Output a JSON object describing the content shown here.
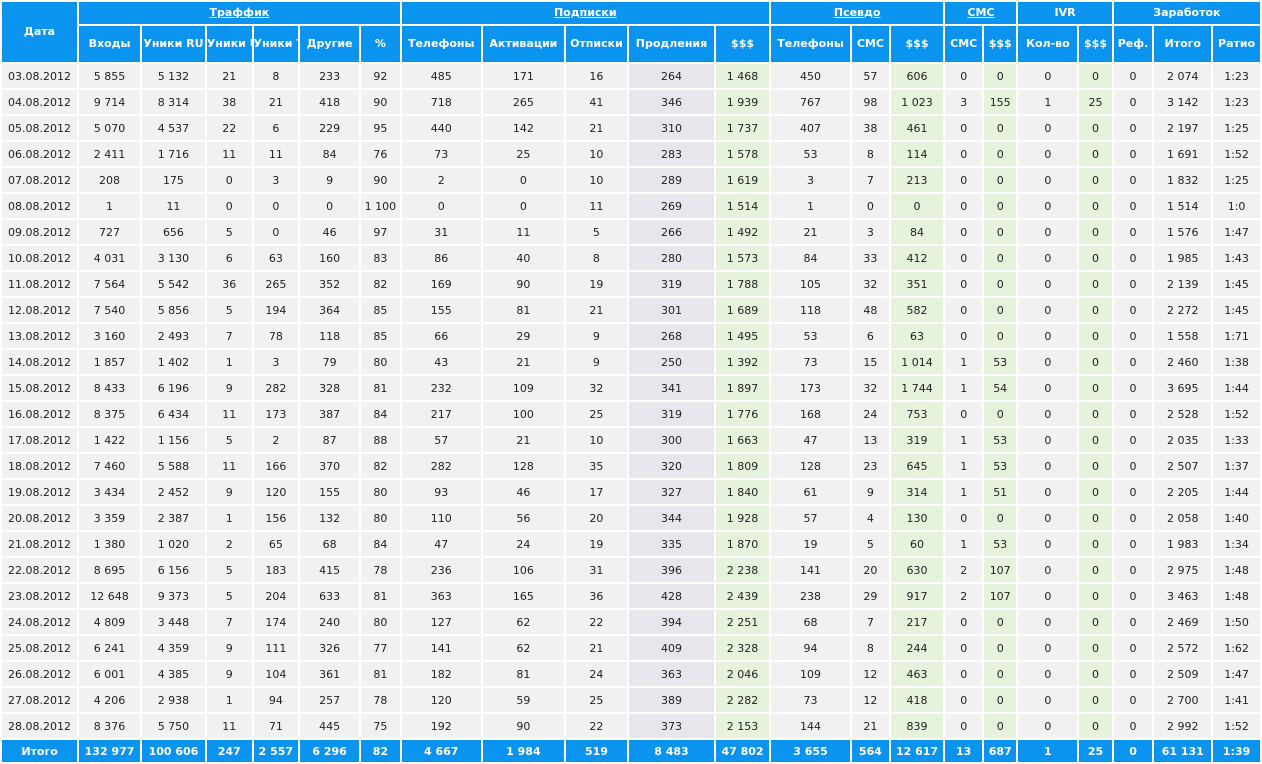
{
  "table": {
    "groups": [
      {
        "label": "Дата",
        "span": 1,
        "link": false,
        "key": "date"
      },
      {
        "label": "Траффик",
        "span": 6,
        "link": true,
        "key": "traffic"
      },
      {
        "label": "Подписки",
        "span": 5,
        "link": true,
        "key": "subscriptions"
      },
      {
        "label": "Псевдо",
        "span": 3,
        "link": true,
        "key": "pseudo"
      },
      {
        "label": "СМС",
        "span": 2,
        "link": true,
        "key": "sms"
      },
      {
        "label": "IVR",
        "span": 2,
        "link": false,
        "key": "ivr"
      },
      {
        "label": "Заработок",
        "span": 3,
        "link": false,
        "key": "earnings"
      }
    ],
    "columns": [
      {
        "label": "Входы",
        "kind": "plain"
      },
      {
        "label": "Уники RU",
        "kind": "plain"
      },
      {
        "label": "Уники UA",
        "kind": "plain"
      },
      {
        "label": "Уники ТБ",
        "kind": "plain"
      },
      {
        "label": "Другие",
        "kind": "plain"
      },
      {
        "label": "%",
        "kind": "plain"
      },
      {
        "label": "Телефоны",
        "kind": "link"
      },
      {
        "label": "Активации",
        "kind": "link"
      },
      {
        "label": "Отписки",
        "kind": "link"
      },
      {
        "label": "Продления",
        "kind": "prod"
      },
      {
        "label": "$$$",
        "kind": "money"
      },
      {
        "label": "Телефоны",
        "kind": "link"
      },
      {
        "label": "СМС",
        "kind": "link"
      },
      {
        "label": "$$$",
        "kind": "money"
      },
      {
        "label": "СМС",
        "kind": "link"
      },
      {
        "label": "$$$",
        "kind": "money"
      },
      {
        "label": "Кол-во",
        "kind": "link"
      },
      {
        "label": "$$$",
        "kind": "money"
      },
      {
        "label": "Реф.",
        "kind": "plain"
      },
      {
        "label": "Итого",
        "kind": "plain"
      },
      {
        "label": "Ратио",
        "kind": "plain"
      }
    ],
    "rows": [
      [
        "03.08.2012",
        "5 855",
        "5 132",
        "21",
        "8",
        "233",
        "92",
        "485",
        "171",
        "16",
        "264",
        "1 468",
        "450",
        "57",
        "606",
        "0",
        "0",
        "0",
        "0",
        "0",
        "2 074",
        "1:23"
      ],
      [
        "04.08.2012",
        "9 714",
        "8 314",
        "38",
        "21",
        "418",
        "90",
        "718",
        "265",
        "41",
        "346",
        "1 939",
        "767",
        "98",
        "1 023",
        "3",
        "155",
        "1",
        "25",
        "0",
        "3 142",
        "1:23"
      ],
      [
        "05.08.2012",
        "5 070",
        "4 537",
        "22",
        "6",
        "229",
        "95",
        "440",
        "142",
        "21",
        "310",
        "1 737",
        "407",
        "38",
        "461",
        "0",
        "0",
        "0",
        "0",
        "0",
        "2 197",
        "1:25"
      ],
      [
        "06.08.2012",
        "2 411",
        "1 716",
        "11",
        "11",
        "84",
        "76",
        "73",
        "25",
        "10",
        "283",
        "1 578",
        "53",
        "8",
        "114",
        "0",
        "0",
        "0",
        "0",
        "0",
        "1 691",
        "1:52"
      ],
      [
        "07.08.2012",
        "208",
        "175",
        "0",
        "3",
        "9",
        "90",
        "2",
        "0",
        "10",
        "289",
        "1 619",
        "3",
        "7",
        "213",
        "0",
        "0",
        "0",
        "0",
        "0",
        "1 832",
        "1:25"
      ],
      [
        "08.08.2012",
        "1",
        "11",
        "0",
        "0",
        "0",
        "1 100",
        "0",
        "0",
        "11",
        "269",
        "1 514",
        "1",
        "0",
        "0",
        "0",
        "0",
        "0",
        "0",
        "0",
        "1 514",
        "1:0"
      ],
      [
        "09.08.2012",
        "727",
        "656",
        "5",
        "0",
        "46",
        "97",
        "31",
        "11",
        "5",
        "266",
        "1 492",
        "21",
        "3",
        "84",
        "0",
        "0",
        "0",
        "0",
        "0",
        "1 576",
        "1:47"
      ],
      [
        "10.08.2012",
        "4 031",
        "3 130",
        "6",
        "63",
        "160",
        "83",
        "86",
        "40",
        "8",
        "280",
        "1 573",
        "84",
        "33",
        "412",
        "0",
        "0",
        "0",
        "0",
        "0",
        "1 985",
        "1:43"
      ],
      [
        "11.08.2012",
        "7 564",
        "5 542",
        "36",
        "265",
        "352",
        "82",
        "169",
        "90",
        "19",
        "319",
        "1 788",
        "105",
        "32",
        "351",
        "0",
        "0",
        "0",
        "0",
        "0",
        "2 139",
        "1:45"
      ],
      [
        "12.08.2012",
        "7 540",
        "5 856",
        "5",
        "194",
        "364",
        "85",
        "155",
        "81",
        "21",
        "301",
        "1 689",
        "118",
        "48",
        "582",
        "0",
        "0",
        "0",
        "0",
        "0",
        "2 272",
        "1:45"
      ],
      [
        "13.08.2012",
        "3 160",
        "2 493",
        "7",
        "78",
        "118",
        "85",
        "66",
        "29",
        "9",
        "268",
        "1 495",
        "53",
        "6",
        "63",
        "0",
        "0",
        "0",
        "0",
        "0",
        "1 558",
        "1:71"
      ],
      [
        "14.08.2012",
        "1 857",
        "1 402",
        "1",
        "3",
        "79",
        "80",
        "43",
        "21",
        "9",
        "250",
        "1 392",
        "73",
        "15",
        "1 014",
        "1",
        "53",
        "0",
        "0",
        "0",
        "2 460",
        "1:38"
      ],
      [
        "15.08.2012",
        "8 433",
        "6 196",
        "9",
        "282",
        "328",
        "81",
        "232",
        "109",
        "32",
        "341",
        "1 897",
        "173",
        "32",
        "1 744",
        "1",
        "54",
        "0",
        "0",
        "0",
        "3 695",
        "1:44"
      ],
      [
        "16.08.2012",
        "8 375",
        "6 434",
        "11",
        "173",
        "387",
        "84",
        "217",
        "100",
        "25",
        "319",
        "1 776",
        "168",
        "24",
        "753",
        "0",
        "0",
        "0",
        "0",
        "0",
        "2 528",
        "1:52"
      ],
      [
        "17.08.2012",
        "1 422",
        "1 156",
        "5",
        "2",
        "87",
        "88",
        "57",
        "21",
        "10",
        "300",
        "1 663",
        "47",
        "13",
        "319",
        "1",
        "53",
        "0",
        "0",
        "0",
        "2 035",
        "1:33"
      ],
      [
        "18.08.2012",
        "7 460",
        "5 588",
        "11",
        "166",
        "370",
        "82",
        "282",
        "128",
        "35",
        "320",
        "1 809",
        "128",
        "23",
        "645",
        "1",
        "53",
        "0",
        "0",
        "0",
        "2 507",
        "1:37"
      ],
      [
        "19.08.2012",
        "3 434",
        "2 452",
        "9",
        "120",
        "155",
        "80",
        "93",
        "46",
        "17",
        "327",
        "1 840",
        "61",
        "9",
        "314",
        "1",
        "51",
        "0",
        "0",
        "0",
        "2 205",
        "1:44"
      ],
      [
        "20.08.2012",
        "3 359",
        "2 387",
        "1",
        "156",
        "132",
        "80",
        "110",
        "56",
        "20",
        "344",
        "1 928",
        "57",
        "4",
        "130",
        "0",
        "0",
        "0",
        "0",
        "0",
        "2 058",
        "1:40"
      ],
      [
        "21.08.2012",
        "1 380",
        "1 020",
        "2",
        "65",
        "68",
        "84",
        "47",
        "24",
        "19",
        "335",
        "1 870",
        "19",
        "5",
        "60",
        "1",
        "53",
        "0",
        "0",
        "0",
        "1 983",
        "1:34"
      ],
      [
        "22.08.2012",
        "8 695",
        "6 156",
        "5",
        "183",
        "415",
        "78",
        "236",
        "106",
        "31",
        "396",
        "2 238",
        "141",
        "20",
        "630",
        "2",
        "107",
        "0",
        "0",
        "0",
        "2 975",
        "1:48"
      ],
      [
        "23.08.2012",
        "12 648",
        "9 373",
        "5",
        "204",
        "633",
        "81",
        "363",
        "165",
        "36",
        "428",
        "2 439",
        "238",
        "29",
        "917",
        "2",
        "107",
        "0",
        "0",
        "0",
        "3 463",
        "1:48"
      ],
      [
        "24.08.2012",
        "4 809",
        "3 448",
        "7",
        "174",
        "240",
        "80",
        "127",
        "62",
        "22",
        "394",
        "2 251",
        "68",
        "7",
        "217",
        "0",
        "0",
        "0",
        "0",
        "0",
        "2 469",
        "1:50"
      ],
      [
        "25.08.2012",
        "6 241",
        "4 359",
        "9",
        "111",
        "326",
        "77",
        "141",
        "62",
        "21",
        "409",
        "2 328",
        "94",
        "8",
        "244",
        "0",
        "0",
        "0",
        "0",
        "0",
        "2 572",
        "1:62"
      ],
      [
        "26.08.2012",
        "6 001",
        "4 385",
        "9",
        "104",
        "361",
        "81",
        "182",
        "81",
        "24",
        "363",
        "2 046",
        "109",
        "12",
        "463",
        "0",
        "0",
        "0",
        "0",
        "0",
        "2 509",
        "1:47"
      ],
      [
        "27.08.2012",
        "4 206",
        "2 938",
        "1",
        "94",
        "257",
        "78",
        "120",
        "59",
        "25",
        "389",
        "2 282",
        "73",
        "12",
        "418",
        "0",
        "0",
        "0",
        "0",
        "0",
        "2 700",
        "1:41"
      ],
      [
        "28.08.2012",
        "8 376",
        "5 750",
        "11",
        "71",
        "445",
        "75",
        "192",
        "90",
        "22",
        "373",
        "2 153",
        "144",
        "21",
        "839",
        "0",
        "0",
        "0",
        "0",
        "0",
        "2 992",
        "1:52"
      ]
    ],
    "totals": [
      "Итого",
      "132 977",
      "100 606",
      "247",
      "2 557",
      "6 296",
      "82",
      "4 667",
      "1 984",
      "519",
      "8 483",
      "47 802",
      "3 655",
      "564",
      "12 617",
      "13",
      "687",
      "1",
      "25",
      "0",
      "61 131",
      "1:39"
    ]
  }
}
